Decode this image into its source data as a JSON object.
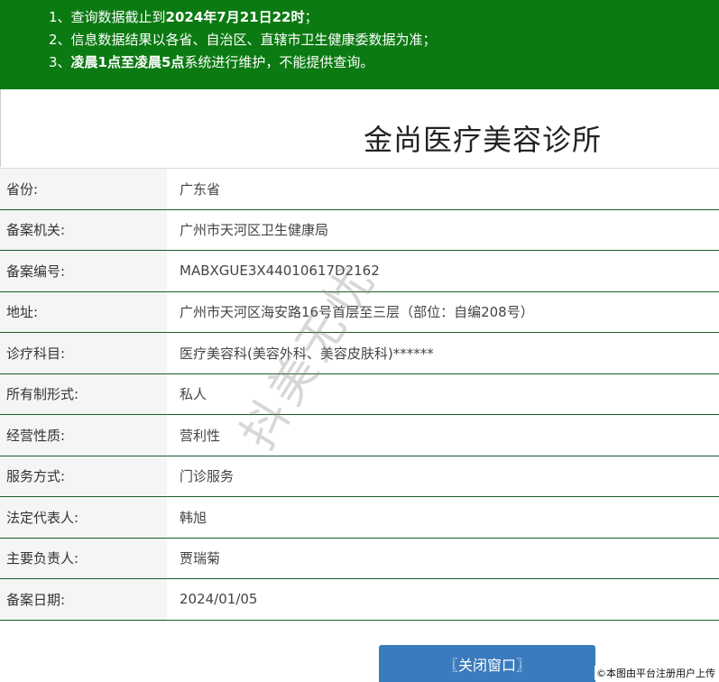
{
  "notice": {
    "line1": {
      "prefix": "1、查询数据截止到",
      "bold": "2024年7月21日22时",
      "suffix": "；"
    },
    "line2": {
      "text": "2、信息数据结果以各省、自治区、直辖市卫生健康委数据为准；"
    },
    "line3": {
      "prefix": "3、",
      "bold": "凌晨1点至凌晨5点",
      "suffix": "系统进行维护，不能提供查询。"
    }
  },
  "title": "金尚医疗美容诊所",
  "rows": [
    {
      "label": "省份:",
      "value": "广东省"
    },
    {
      "label": "备案机关:",
      "value": "广州市天河区卫生健康局"
    },
    {
      "label": "备案编号:",
      "value": "MABXGUE3X44010617D2162"
    },
    {
      "label": "地址:",
      "value": "广州市天河区海安路16号首层至三层（部位：自编208号）"
    },
    {
      "label": "诊疗科目:",
      "value": "医疗美容科(美容外科、美容皮肤科)******"
    },
    {
      "label": "所有制形式:",
      "value": "私人"
    },
    {
      "label": "经营性质:",
      "value": "营利性"
    },
    {
      "label": "服务方式:",
      "value": "门诊服务"
    },
    {
      "label": "法定代表人:",
      "value": "韩旭"
    },
    {
      "label": "主要负责人:",
      "value": "贾瑞菊"
    },
    {
      "label": "备案日期:",
      "value": "2024/01/05"
    }
  ],
  "close_button": "〖关闭窗口〗",
  "watermark": "抖美无忧",
  "credit": "©本图由平台注册用户上传"
}
